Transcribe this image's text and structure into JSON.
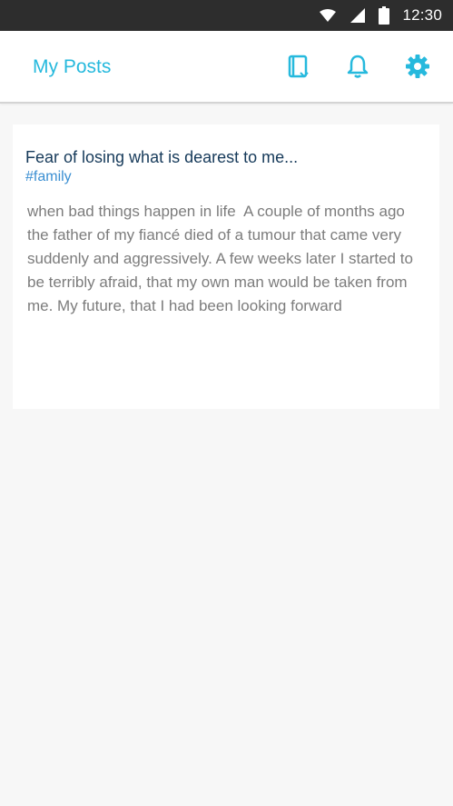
{
  "status_bar": {
    "time": "12:30",
    "icons": [
      "wifi-icon",
      "signal-icon",
      "battery-icon"
    ],
    "background": "#2d2d2d"
  },
  "app_bar": {
    "title": "My Posts",
    "title_color": "#26b9dd",
    "actions": [
      "journal-icon",
      "bell-icon",
      "gear-icon"
    ]
  },
  "posts": [
    {
      "title": "Fear of losing what is dearest to me...",
      "tag": "#family",
      "body": "when bad things happen in life  A couple of months ago the father of my fiancé died of a tumour that came very suddenly and aggressively. A few weeks later I started to be terribly afraid, that my own man would be taken from me. My future, that I had been looking forward"
    }
  ],
  "colors": {
    "accent": "#26b9dd",
    "post_title": "#163a5a",
    "tag": "#3b8fd2",
    "body_text": "#7c7c7c",
    "page_background": "#f7f7f7"
  }
}
